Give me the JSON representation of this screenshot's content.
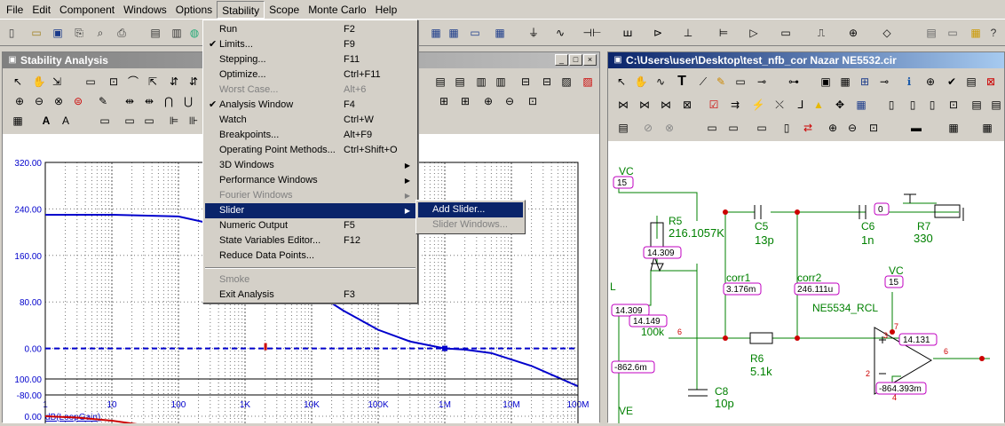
{
  "menubar": [
    "File",
    "Edit",
    "Component",
    "Windows",
    "Options",
    "Stability",
    "Scope",
    "Monte Carlo",
    "Help"
  ],
  "stability_window": {
    "title": "Stability Analysis"
  },
  "schematic_window": {
    "title": "C:\\Users\\user\\Desktop\\test_nfb_cor Nazar NE5532.cir"
  },
  "stability_menu": [
    {
      "label": "Run",
      "shortcut": "F2",
      "check": "",
      "submenu": false,
      "disabled": false
    },
    {
      "label": "Limits...",
      "shortcut": "F9",
      "check": "✔",
      "submenu": false,
      "disabled": false
    },
    {
      "label": "Stepping...",
      "shortcut": "F11",
      "check": "",
      "submenu": false,
      "disabled": false
    },
    {
      "label": "Optimize...",
      "shortcut": "Ctrl+F11",
      "check": "",
      "submenu": false,
      "disabled": false
    },
    {
      "label": "Worst Case...",
      "shortcut": "Alt+6",
      "check": "",
      "submenu": false,
      "disabled": true
    },
    {
      "label": "Analysis Window",
      "shortcut": "F4",
      "check": "✔",
      "submenu": false,
      "disabled": false
    },
    {
      "label": "Watch",
      "shortcut": "Ctrl+W",
      "check": "",
      "submenu": false,
      "disabled": false
    },
    {
      "label": "Breakpoints...",
      "shortcut": "Alt+F9",
      "check": "",
      "submenu": false,
      "disabled": false
    },
    {
      "label": "Operating Point Methods...",
      "shortcut": "Ctrl+Shift+O",
      "check": "",
      "submenu": false,
      "disabled": false
    },
    {
      "label": "3D Windows",
      "shortcut": "",
      "check": "",
      "submenu": true,
      "disabled": false
    },
    {
      "label": "Performance Windows",
      "shortcut": "",
      "check": "",
      "submenu": true,
      "disabled": false
    },
    {
      "label": "Fourier Windows",
      "shortcut": "",
      "check": "",
      "submenu": true,
      "disabled": true
    },
    {
      "label": "Slider",
      "shortcut": "",
      "check": "",
      "submenu": true,
      "disabled": false,
      "selected": true
    },
    {
      "label": "Numeric Output",
      "shortcut": "F5",
      "check": "",
      "submenu": false,
      "disabled": false
    },
    {
      "label": "State Variables Editor...",
      "shortcut": "F12",
      "check": "",
      "submenu": false,
      "disabled": false
    },
    {
      "label": "Reduce Data Points...",
      "shortcut": "",
      "check": "",
      "submenu": false,
      "disabled": false
    },
    {
      "label": "Smoke",
      "shortcut": "",
      "check": "",
      "submenu": false,
      "disabled": true
    },
    {
      "label": "Exit Analysis",
      "shortcut": "F3",
      "check": "",
      "submenu": false,
      "disabled": false
    }
  ],
  "slider_submenu": [
    {
      "label": "Add Slider...",
      "disabled": false,
      "selected": true
    },
    {
      "label": "Slider Windows...",
      "disabled": true
    }
  ],
  "chart_data": [
    {
      "type": "line",
      "ylabel": "dB(LoopGain)",
      "ylim": [
        -80,
        320
      ],
      "yticks": [
        "320.00",
        "240.00",
        "160.00",
        "80.00",
        "0.00",
        "-80.00"
      ],
      "x_scale": "log",
      "xlim": [
        1,
        100000000
      ],
      "xticks": [
        "1",
        "10",
        "100",
        "1K",
        "10K",
        "100K",
        "1M",
        "10M",
        "100M"
      ],
      "series": [
        {
          "color": "#0000cc",
          "style": "solid",
          "x": [
            1,
            10,
            100,
            300,
            1000,
            3000,
            10000,
            30000,
            100000,
            300000,
            1000000,
            2000000,
            5000000,
            20000000,
            100000000
          ],
          "y": [
            230,
            230,
            227,
            215,
            185,
            145,
            100,
            65,
            32,
            12,
            0,
            -2,
            -8,
            -30,
            -65
          ]
        },
        {
          "color": "#0000cc",
          "style": "dashed",
          "x": [
            1,
            100000000
          ],
          "y": [
            0,
            0
          ]
        }
      ]
    },
    {
      "type": "line",
      "yticks": [
        "100.00",
        "0.00"
      ],
      "ylim": [
        -50,
        100
      ],
      "x_scale": "log",
      "xlim": [
        1,
        100000000
      ],
      "series": [
        {
          "color": "#cc0000",
          "style": "solid",
          "x": [
            1,
            3,
            10,
            30
          ],
          "y": [
            0,
            -3,
            -10,
            -20
          ]
        }
      ]
    }
  ],
  "schematic": {
    "labels": [
      "VC",
      "15",
      "R5",
      "216.1057K",
      "14.309",
      "C5",
      "13p",
      "C6",
      "1n",
      "0",
      "R7",
      "330",
      "corr1",
      "3.176m",
      "corr2",
      "246.111u",
      "VC",
      "15",
      "NE5534_RCL",
      "L",
      "14.309",
      "14.149",
      "100k",
      "6",
      "R6",
      "5.1k",
      "3",
      "7",
      "14.131",
      "-862.6m",
      "6",
      "2",
      "4",
      "-864.393m",
      "C8",
      "10p",
      "VE"
    ]
  }
}
